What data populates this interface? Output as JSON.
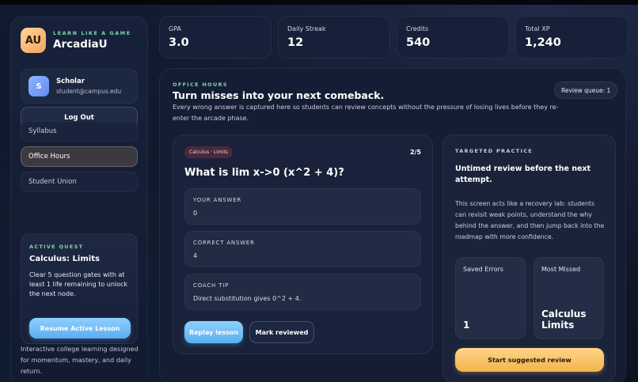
{
  "brand": {
    "tagline": "LEARN LIKE A GAME",
    "name": "ArcadiaU",
    "logo_text": "AU"
  },
  "user": {
    "initial": "S",
    "name": "Scholar",
    "email": "student@campus.edu"
  },
  "sidebar": {
    "logout_label": "Log Out",
    "items": [
      {
        "label": "Syllabus",
        "active": false
      },
      {
        "label": "Office Hours",
        "active": true
      },
      {
        "label": "Student Union",
        "active": false
      }
    ],
    "footer": "Interactive college learning designed for momentum, mastery, and daily return."
  },
  "quest": {
    "tag": "ACTIVE QUEST",
    "title": "Calculus: Limits",
    "description": "Clear 5 question gates with at least 1 life remaining to unlock the next node.",
    "button_label": "Resume Active Lesson"
  },
  "stats": [
    {
      "label": "GPA",
      "value": "3.0"
    },
    {
      "label": "Daily Streak",
      "value": "12"
    },
    {
      "label": "Credits",
      "value": "540"
    },
    {
      "label": "Total XP",
      "value": "1,240"
    }
  ],
  "office_hours": {
    "tag": "OFFICE HOURS",
    "title": "Turn misses into your next comeback.",
    "description": "Every wrong answer is captured here so students can review concepts without the pressure of losing lives before they re-enter the arcade phase.",
    "queue_label": "Review queue: 1"
  },
  "question_card": {
    "chip": "Calculus · Limits",
    "counter": "2/5",
    "question": "What is lim x->0 (x^2 + 4)?",
    "your_answer_label": "YOUR ANSWER",
    "your_answer": "0",
    "correct_answer_label": "CORRECT ANSWER",
    "correct_answer": "4",
    "coach_tip_label": "COACH TIP",
    "coach_tip": "Direct substitution gives 0^2 + 4.",
    "replay_label": "Replay lesson",
    "mark_label": "Mark reviewed"
  },
  "practice": {
    "tag": "TARGETED PRACTICE",
    "title": "Untimed review before the next attempt.",
    "description": "This screen acts like a recovery lab: students can revisit weak points, understand the why behind the answer, and then jump back into the roadmap with more confidence.",
    "saved_errors_label": "Saved Errors",
    "saved_errors_value": "1",
    "most_missed_label": "Most Missed",
    "most_missed_value": "Calculus Limits",
    "button_label": "Start suggested review"
  },
  "colors": {
    "accent_green": "#7fd6b0",
    "accent_blue": "#5aaef0",
    "accent_gold": "#f2b44c"
  }
}
